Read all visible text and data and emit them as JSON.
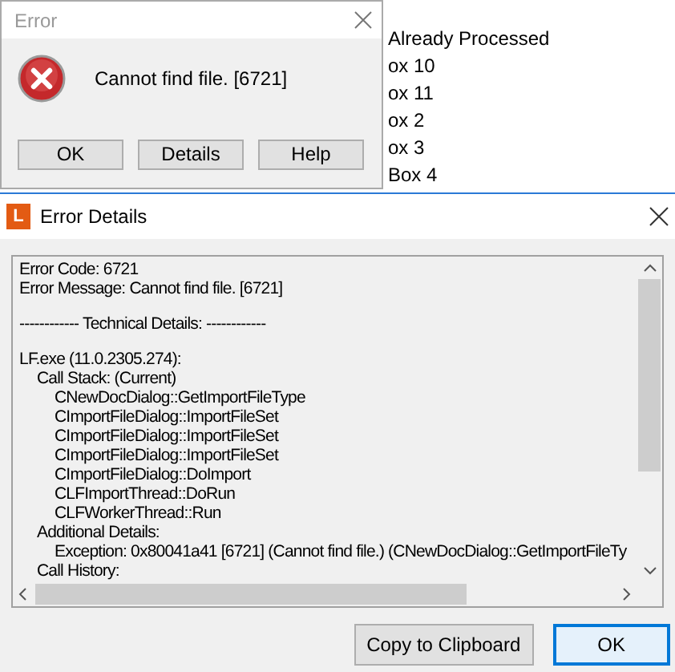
{
  "background_tree": {
    "items": [
      {
        "label": "Already Processed"
      },
      {
        "label": "ox 10"
      },
      {
        "label": "ox 11"
      },
      {
        "label": "ox 2"
      },
      {
        "label": "ox 3"
      },
      {
        "label": "Box 4"
      }
    ]
  },
  "error_dialog": {
    "title": "Error",
    "message": "Cannot find file. [6721]",
    "buttons": [
      "OK",
      "Details",
      "Help"
    ]
  },
  "details_window": {
    "title": "Error Details",
    "app_icon_letter": "L",
    "paragraphs": [
      [
        {
          "text": "Error Code: 6721"
        },
        {
          "text": "Error Message: Cannot find file. [6721]"
        }
      ],
      [
        {
          "text": "------------ Technical Details: ------------"
        }
      ],
      [
        {
          "text": "LF.exe (11.0.2305.274):",
          "children": [
            {
              "text": "Call Stack: (Current)",
              "children": [
                {
                  "text": "CNewDocDialog::GetImportFileType"
                },
                {
                  "text": "CImportFileDialog::ImportFileSet"
                },
                {
                  "text": "CImportFileDialog::ImportFileSet"
                },
                {
                  "text": "CImportFileDialog::ImportFileSet"
                },
                {
                  "text": "CImportFileDialog::DoImport"
                },
                {
                  "text": "CLFImportThread::DoRun"
                },
                {
                  "text": "CLFWorkerThread::Run"
                }
              ]
            },
            {
              "text": "Additional Details:",
              "children": [
                {
                  "text": "Exception: 0x80041a41 [6721] (Cannot find file.) (CNewDocDialog::GetImportFileTy"
                }
              ]
            },
            {
              "text": "Call History:"
            }
          ]
        }
      ]
    ],
    "buttons": [
      {
        "label": "Copy to Clipboard",
        "default": false
      },
      {
        "label": "OK",
        "default": true
      }
    ]
  }
}
